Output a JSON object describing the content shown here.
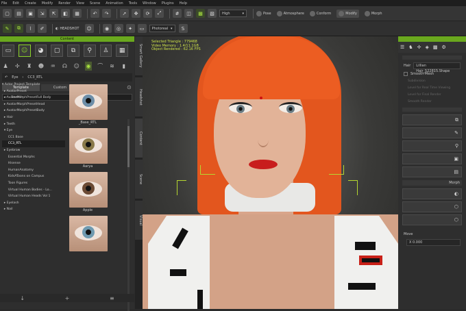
{
  "menu": [
    "File",
    "Edit",
    "Create",
    "Modify",
    "Render",
    "View",
    "Scene",
    "Animation",
    "Tools",
    "Window",
    "Plugins",
    "Help"
  ],
  "toolbar1": {
    "quality": "High",
    "pose": "Pose",
    "atmosphere": "Atmosphere",
    "conform": "Conform",
    "modify": "Modify",
    "morph": "Morph"
  },
  "toolbar2": {
    "headshot": "HEADSHOT",
    "photoreal": "Photoreal"
  },
  "content": {
    "header": "Content",
    "path": [
      "↶",
      "Eye",
      "CC3_RTL"
    ],
    "tabs": [
      "Template",
      "Custom"
    ],
    "search_placeholder": "Search",
    "tree": [
      "▾ Actor Project Template",
      "  ▸ AvatarPreset",
      "  ▸ AvatarMorphPresetFull Body",
      "  ▸ AvatarMorphPresetHead",
      "  ▸ AvatarMorphPresetBody",
      "  ▸ Hair",
      "  ▸ Teeth",
      "  ▾ Eye",
      "      CC1 Base",
      "      CC3_RTL",
      "  ▸ Eyebrow",
      "      Essential Morphs",
      "      Hisense",
      "      HumanAnatomy",
      "      KidsAToons on Campus",
      "      Toon Figures",
      "      Virtual Human Bodies - Lo...",
      "      Virtual Human Heads Vol 1",
      "  ▸ Eyelash",
      "  ▸ Nail"
    ],
    "thumbs": [
      {
        "label": "_Base_RTL",
        "iris": "#6d8ea8"
      },
      {
        "label": "Aarya",
        "iris": "#8a7a4a"
      },
      {
        "label": "Apple",
        "iris": "#6b4a34"
      },
      {
        "label": "",
        "iris": "#6f9ab0"
      }
    ]
  },
  "side_tabs": [
    "Smart Gallery",
    "Headshot",
    "Content",
    "Scene",
    "Visual"
  ],
  "viewport": {
    "stats": [
      "Selected Triangle : 779468",
      "Video Memory : 1.4/11.1GB",
      "Object Rendered : 62.16 FPS"
    ]
  },
  "modify": {
    "hair_label": "Hair",
    "hair_value": "Lillian Hair_522815.Shape",
    "smooth_mesh": "Smooth Mesh",
    "subdivision": "Subdivision",
    "level_real": "Level for Real Time Viewing",
    "level_render": "Level for Final Render",
    "smooth_render": "Smooth Render",
    "morph_section": "Morph",
    "move_label": "Move",
    "move_value": "X 0.000"
  },
  "colors": {
    "accent_green": "#6aa81e",
    "highlight_green": "#a8e040",
    "hair_orange": "#e3561e",
    "lip_red": "#c81d1d"
  }
}
